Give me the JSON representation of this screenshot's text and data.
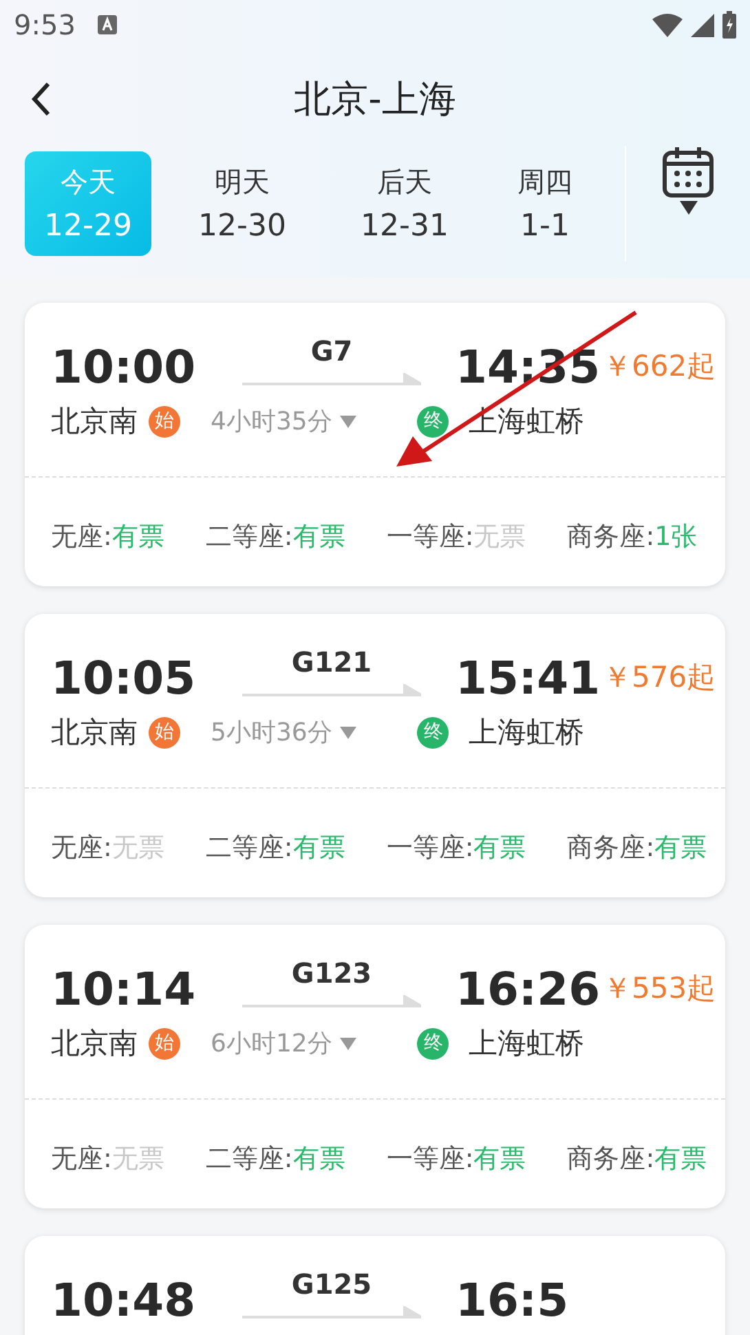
{
  "status_bar": {
    "time": "9:53"
  },
  "header": {
    "title": "北京-上海"
  },
  "dates": [
    {
      "day": "今天",
      "date": "12-29",
      "selected": true
    },
    {
      "day": "明天",
      "date": "12-30",
      "selected": false
    },
    {
      "day": "后天",
      "date": "12-31",
      "selected": false
    },
    {
      "day": "周四",
      "date": "1-1",
      "selected": false
    }
  ],
  "trains": [
    {
      "depart": "10:00",
      "train": "G7",
      "arrive": "14:35",
      "price": "￥662起",
      "duration": "4小时35分",
      "from": "北京南",
      "from_badge": "始",
      "to": "上海虹桥",
      "to_badge": "终",
      "seats": [
        {
          "name": "无座:",
          "status": "有票",
          "available": true
        },
        {
          "name": "二等座:",
          "status": "有票",
          "available": true
        },
        {
          "name": "一等座:",
          "status": "无票",
          "available": false
        },
        {
          "name": "商务座:",
          "status": "1张",
          "available": true
        }
      ]
    },
    {
      "depart": "10:05",
      "train": "G121",
      "arrive": "15:41",
      "price": "￥576起",
      "duration": "5小时36分",
      "from": "北京南",
      "from_badge": "始",
      "to": "上海虹桥",
      "to_badge": "终",
      "seats": [
        {
          "name": "无座:",
          "status": "无票",
          "available": false
        },
        {
          "name": "二等座:",
          "status": "有票",
          "available": true
        },
        {
          "name": "一等座:",
          "status": "有票",
          "available": true
        },
        {
          "name": "商务座:",
          "status": "有票",
          "available": true
        }
      ]
    },
    {
      "depart": "10:14",
      "train": "G123",
      "arrive": "16:26",
      "price": "￥553起",
      "duration": "6小时12分",
      "from": "北京南",
      "from_badge": "始",
      "to": "上海虹桥",
      "to_badge": "终",
      "seats": [
        {
          "name": "无座:",
          "status": "无票",
          "available": false
        },
        {
          "name": "二等座:",
          "status": "有票",
          "available": true
        },
        {
          "name": "一等座:",
          "status": "有票",
          "available": true
        },
        {
          "name": "商务座:",
          "status": "有票",
          "available": true
        }
      ]
    },
    {
      "depart": "10:48",
      "train": "G125",
      "arrive": "16:5"
    }
  ]
}
